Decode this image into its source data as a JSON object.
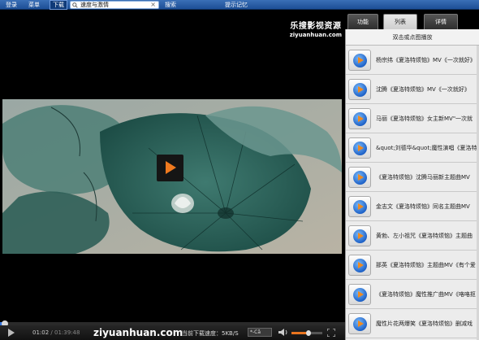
{
  "toolbar": {
    "login_label": "登录",
    "menu_label": "菜单",
    "download_label": "下载",
    "search_value": "速度与激情",
    "search_clear": "×",
    "search_button_label": "搜索",
    "history_label": "提示记忆"
  },
  "brand": {
    "name": "乐搜影视资源",
    "url": "ziyuanhuan.com"
  },
  "tabs": {
    "function_label": "功能",
    "list_label": "列表",
    "detail_label": "详情",
    "active": "list"
  },
  "playlist": {
    "header": "双击或点图播放",
    "items": [
      {
        "title": "杨宗纬《夏洛特烦恼》MV《一次就好》"
      },
      {
        "title": "沈腾《夏洛特烦恼》MV《一次就好》"
      },
      {
        "title": "马丽《夏洛特烦恼》女主新MV\"一次就"
      },
      {
        "title": "&quot;刘德华&quot;魔性演唱《夏洛特"
      },
      {
        "title": "《夏洛特烦恼》沈腾马丽新主题曲MV"
      },
      {
        "title": "金志文《夏洛特烦恼》同名主题曲MV"
      },
      {
        "title": "黄勃、左小祖咒《夏洛特烦恼》主题曲"
      },
      {
        "title": "那英《夏洛特烦恼》主题曲MV《有个爱"
      },
      {
        "title": "《夏洛特烦恼》魔性推广曲MV《咯咯抠"
      },
      {
        "title": "魔性片花两爆笑《夏洛特烦恼》删减戏"
      }
    ]
  },
  "controls": {
    "current_time": "01:02",
    "duration": " / 01:39:48",
    "site": "ziyuanhuan.com",
    "speed_text": "当前下载速度：5KB/S",
    "caption_box": "*-Cã",
    "progress_fraction": 0.01,
    "volume_fraction": 0.55
  },
  "colors": {
    "toolbar": "#1d4f96",
    "accent": "#f07a1f",
    "progress": "#2f6fd8"
  },
  "icons": {
    "search": "search-icon",
    "play": "play-icon",
    "speaker": "speaker-icon",
    "fullscreen": "fullscreen-icon"
  }
}
